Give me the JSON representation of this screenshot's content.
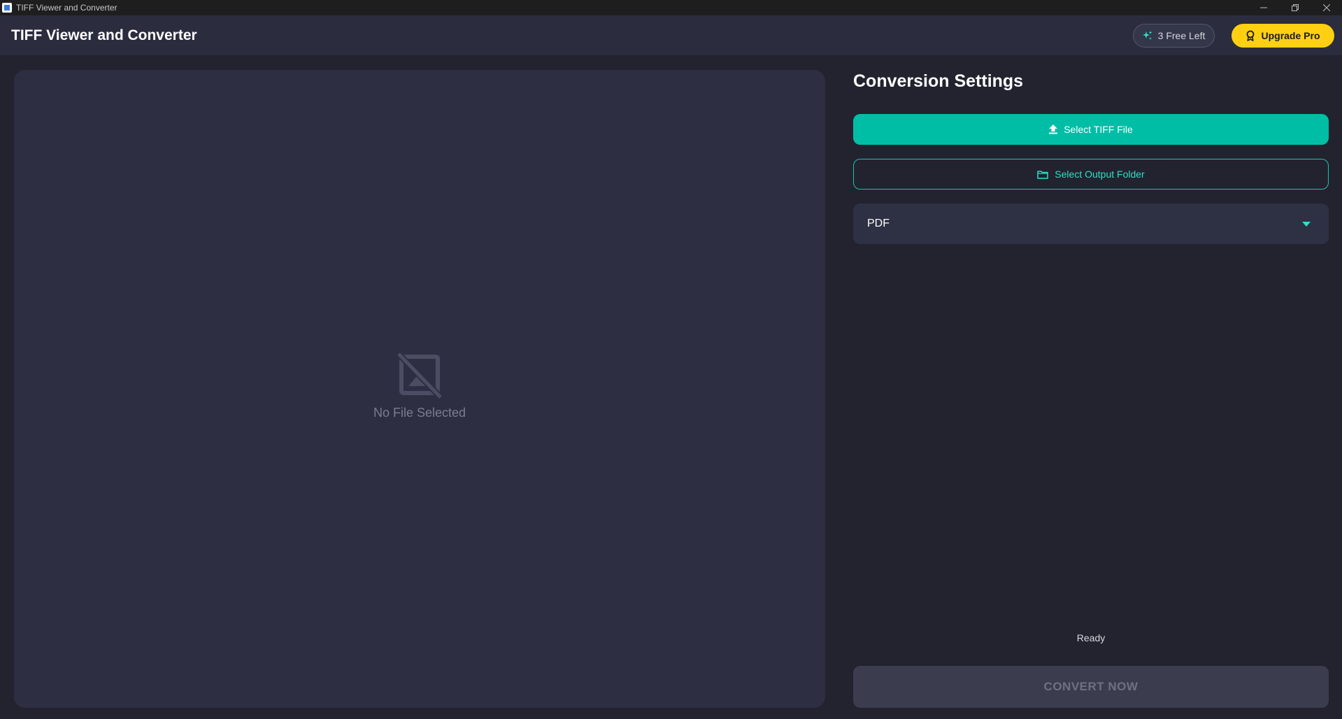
{
  "window": {
    "title": "TIFF Viewer and Converter",
    "controls": {
      "minimize_icon": "minimize-icon",
      "restore_icon": "restore-icon",
      "close_icon": "close-icon"
    }
  },
  "header": {
    "app_title": "TIFF Viewer and Converter",
    "free_left_label": "3 Free Left",
    "free_left_icon": "sparkle-icon",
    "upgrade_label": "Upgrade Pro",
    "upgrade_icon": "badge-icon"
  },
  "preview": {
    "placeholder_icon": "no-image-icon",
    "placeholder_text": "No File Selected"
  },
  "settings": {
    "title": "Conversion Settings",
    "select_file_label": "Select TIFF File",
    "select_file_icon": "upload-icon",
    "select_folder_label": "Select Output Folder",
    "select_folder_icon": "folder-icon",
    "format_selected": "PDF",
    "format_caret_icon": "caret-down-icon",
    "status_text": "Ready",
    "convert_label": "CONVERT NOW"
  },
  "colors": {
    "accent_teal": "#00bea6",
    "upgrade_yellow": "#ffd012",
    "background": "#22232f",
    "panel": "#2d2e42"
  }
}
